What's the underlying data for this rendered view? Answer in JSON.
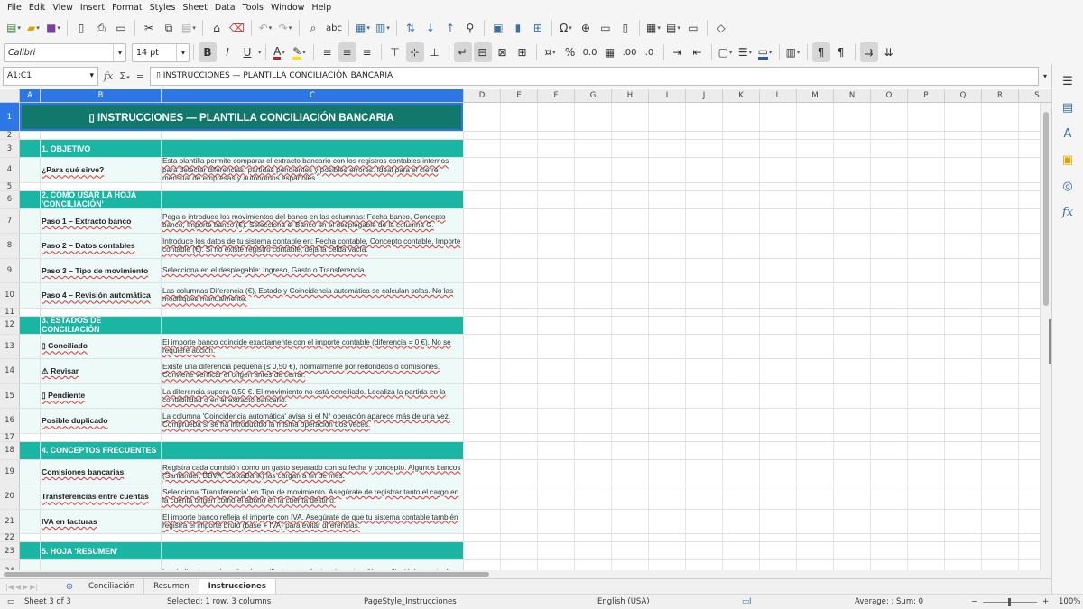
{
  "menu": [
    "File",
    "Edit",
    "View",
    "Insert",
    "Format",
    "Styles",
    "Sheet",
    "Data",
    "Tools",
    "Window",
    "Help"
  ],
  "toolbar2": {
    "font_name": "Calibri",
    "font_size": "14 pt",
    "bold": "B",
    "italic": "I",
    "underline": "U",
    "percent": "%",
    "decimal": "0.0",
    "add_decimal": ".00",
    "del_decimal": ".0"
  },
  "formula_bar": {
    "name_box": "A1:C1",
    "content": "▯ INSTRUCCIONES — PLANTILLA CONCILIACIÓN BANCARIA"
  },
  "columns": [
    "A",
    "B",
    "C",
    "D",
    "E",
    "F",
    "G",
    "H",
    "I",
    "J",
    "K",
    "L",
    "M",
    "N",
    "O",
    "P",
    "Q",
    "R",
    "S"
  ],
  "title": "▯ INSTRUCCIONES — PLANTILLA CONCILIACIÓN BANCARIA",
  "rows": [
    {
      "n": "1",
      "type": "title"
    },
    {
      "n": "2",
      "type": "spacer"
    },
    {
      "n": "3",
      "type": "section",
      "b": "1. OBJETIVO"
    },
    {
      "n": "4",
      "type": "item",
      "b": "¿Para qué sirve?",
      "c": "Esta plantilla permite comparar el extracto bancario con los registros contables internos para detectar diferencias, partidas pendientes y posibles errores. Ideal para el cierre mensual de empresas y autónomos españoles."
    },
    {
      "n": "5",
      "type": "spacer"
    },
    {
      "n": "6",
      "type": "section",
      "b": "2. CÓMO USAR LA HOJA 'CONCILIACIÓN'"
    },
    {
      "n": "7",
      "type": "item",
      "b": "Paso 1 – Extracto banco",
      "c": "Pega o introduce los movimientos del banco en las columnas: Fecha banco, Concepto banco, Importe banco (€). Selecciona el Banco en el desplegable de la columna G."
    },
    {
      "n": "8",
      "type": "item",
      "b": "Paso 2 – Datos contables",
      "c": "Introduce los datos de tu sistema contable en: Fecha contable, Concepto contable, Importe contable (€). Si no existe registro contable, deja la celda vacía."
    },
    {
      "n": "9",
      "type": "item",
      "b": "Paso 3 – Tipo de movimiento",
      "c": "Selecciona en el desplegable: Ingreso, Gasto o Transferencia."
    },
    {
      "n": "10",
      "type": "item",
      "b": "Paso 4 – Revisión automática",
      "c": "Las columnas Diferencia (€), Estado y Coincidencia automática se calculan solas. No las modifiques manualmente."
    },
    {
      "n": "11",
      "type": "spacer"
    },
    {
      "n": "12",
      "type": "section",
      "b": "3. ESTADOS DE CONCILIACIÓN"
    },
    {
      "n": "13",
      "type": "item",
      "b": "▯ Conciliado",
      "c": "El importe banco coincide exactamente con el importe contable (diferencia = 0 €). No se requiere acción."
    },
    {
      "n": "14",
      "type": "item",
      "b": "⚠ Revisar",
      "c": "Existe una diferencia pequeña (≤ 0,50 €), normalmente por redondeos o comisiones. Conviene verificar el origen antes de cerrar."
    },
    {
      "n": "15",
      "type": "item",
      "b": "▯ Pendiente",
      "c": "La diferencia supera 0,50 €. El movimiento no está conciliado. Localiza la partida en la contabilidad o en el extracto bancario."
    },
    {
      "n": "16",
      "type": "item",
      "b": "Posible duplicado",
      "c": "La columna 'Coincidencia automática' avisa si el N° operación aparece más de una vez. Comprueba si se ha introducido la misma operación dos veces."
    },
    {
      "n": "17",
      "type": "spacer"
    },
    {
      "n": "18",
      "type": "section",
      "b": "4. CONCEPTOS FRECUENTES"
    },
    {
      "n": "19",
      "type": "item",
      "b": "Comisiones bancarias",
      "c": "Registra cada comisión como un gasto separado con su fecha y concepto. Algunos bancos (Santander, BBVA, CaixaBank) las cargan a fin de mes."
    },
    {
      "n": "20",
      "type": "item",
      "b": "Transferencias entre cuentas",
      "c": "Selecciona 'Transferencia' en Tipo de movimiento. Asegúrate de registrar tanto el cargo en la cuenta origen como el abono en la cuenta destino."
    },
    {
      "n": "21",
      "type": "item",
      "b": "IVA en facturas",
      "c": "El importe banco refleja el importe con IVA. Asegúrate de que tu sistema contable también registra el importe bruto (base + IVA) para evitar diferencias."
    },
    {
      "n": "22",
      "type": "spacer"
    },
    {
      "n": "23",
      "type": "section",
      "b": "5. HOJA 'RESUMEN'"
    },
    {
      "n": "24",
      "type": "item",
      "b": "",
      "c": "Los indicadores clave (total conciliados, pendientes, importes, % conciliación) se actualizan"
    }
  ],
  "tabs": [
    "Conciliación",
    "Resumen",
    "Instrucciones"
  ],
  "active_tab": "Instrucciones",
  "status": {
    "sheet": "Sheet 3 of 3",
    "selection": "Selected: 1 row, 3 columns",
    "page_style": "PageStyle_Instrucciones",
    "language": "English (USA)",
    "sum": "Average: ; Sum: 0",
    "zoom": "100%"
  },
  "colors": {
    "title_bg": "#13786c",
    "section_bg": "#1bb6a3",
    "item_bg": "#eefaf8",
    "selection": "#2c76e6"
  }
}
